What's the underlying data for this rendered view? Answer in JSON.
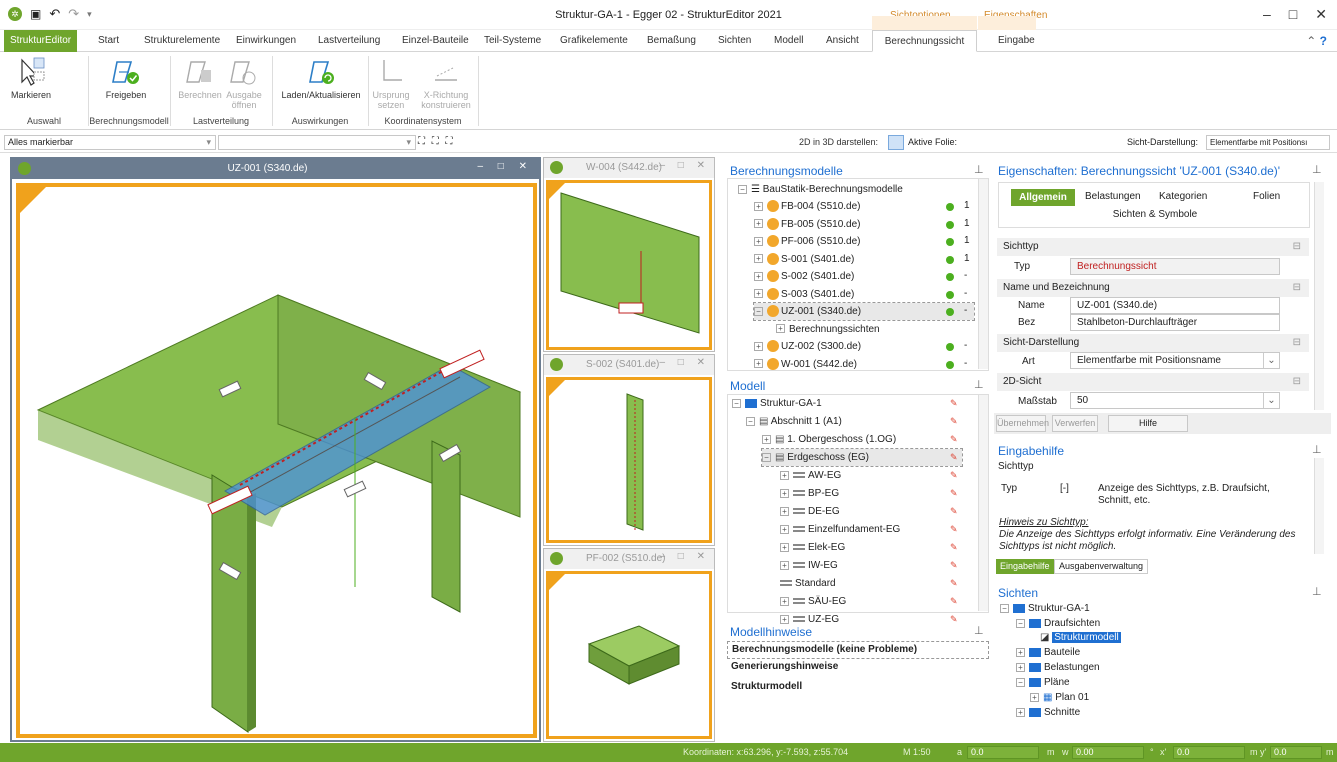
{
  "app": {
    "title": "Struktur-GA-1 - Egger 02 - StrukturEditor 2021",
    "context_tab1": "Sichtoptionen",
    "context_tab2": "Eigenschaften",
    "minimize": "–",
    "maximize": "□",
    "close": "✕"
  },
  "tabs": [
    "StrukturEditor",
    "Start",
    "Strukturelemente",
    "Einwirkungen",
    "Lastverteilung",
    "Einzel-Bauteile",
    "Teil-Systeme",
    "Grafikelemente",
    "Bemaßung",
    "Sichten",
    "Modell",
    "Ansicht",
    "Berechnungssicht",
    "Eingabe"
  ],
  "ribbon": {
    "markieren": "Markieren",
    "freigeben": "Freigeben",
    "berechnen": "Berechnen",
    "ausgabe": "Ausgabe\nöffnen",
    "laden": "Laden/Aktualisieren",
    "ursprung": "Ursprung\nsetzen",
    "xrichtung": "X-Richtung\nkonstruieren",
    "groups": [
      "Auswahl",
      "Berechnungsmodell",
      "Lastverteilung",
      "Auswirkungen",
      "Koordinatensystem"
    ]
  },
  "toolbar": {
    "selection": "Alles markierbar",
    "view2d": "2D in 3D darstellen:",
    "active_layer": "Aktive Folie:",
    "sicht_label": "Sicht-Darstellung:",
    "sicht_value": "Elementfarbe mit Positionsı"
  },
  "views": {
    "main": "UZ-001 (S340.de)",
    "w004": "W-004 (S442.de)",
    "s002": "S-002 (S401.de)",
    "pf002": "PF-002 (S510.de)"
  },
  "berechnungsmodelle": {
    "title": "Berechnungsmodelle",
    "root": "BauStatik-Berechnungsmodelle",
    "items": [
      {
        "label": "FB-004 (S510.de)",
        "col": "1"
      },
      {
        "label": "FB-005 (S510.de)",
        "col": "1"
      },
      {
        "label": "PF-006 (S510.de)",
        "col": "1"
      },
      {
        "label": "S-001 (S401.de)",
        "col": "1"
      },
      {
        "label": "S-002 (S401.de)",
        "col": "-"
      },
      {
        "label": "S-003 (S401.de)",
        "col": "-"
      },
      {
        "label": "UZ-001 (S340.de)",
        "col": "-"
      },
      {
        "label": "Berechnungssichten",
        "col": ""
      },
      {
        "label": "UZ-002 (S300.de)",
        "col": "-"
      },
      {
        "label": "W-001 (S442.de)",
        "col": "-"
      }
    ]
  },
  "modell": {
    "title": "Modell",
    "items": [
      "Struktur-GA-1",
      "Abschnitt 1 (A1)",
      "1. Obergeschoss (1.OG)",
      "Erdgeschoss (EG)",
      "AW-EG",
      "BP-EG",
      "DE-EG",
      "Einzelfundament-EG",
      "Elek-EG",
      "IW-EG",
      "Standard",
      "SÄU-EG",
      "UZ-EG"
    ]
  },
  "hinweise": {
    "title": "Modellhinweise",
    "items": [
      "Berechnungsmodelle (keine Probleme)",
      "Generierungshinweise",
      "Strukturmodell"
    ]
  },
  "eigenschaften": {
    "title": "Eigenschaften: Berechnungssicht 'UZ-001 (S340.de)'",
    "tabs": [
      "Allgemein",
      "Belastungen",
      "Kategorien",
      "Folien",
      "Sichten & Symbole"
    ],
    "sichttyp": "Sichttyp",
    "typ_label": "Typ",
    "typ_value": "Berechnungssicht",
    "name_section": "Name und Bezeichnung",
    "name_label": "Name",
    "name_value": "UZ-001 (S340.de)",
    "bez_label": "Bez",
    "bez_value": "Stahlbeton-Durchlaufträger",
    "sicht_section": "Sicht-Darstellung",
    "art_label": "Art",
    "art_value": "Elementfarbe mit Positionsname",
    "sicht2d": "2D-Sicht",
    "massstab_label": "Maßstab",
    "massstab_value": "50",
    "btn_uebernehmen": "Übernehmen",
    "btn_verwerfen": "Verwerfen",
    "btn_hilfe": "Hilfe"
  },
  "eingabehilfe": {
    "title": "Eingabehilfe",
    "subtitle": "Sichttyp",
    "typ": "Typ",
    "unit": "[-]",
    "desc": "Anzeige des Sichttyps, z.B. Draufsicht, Schnitt, etc.",
    "hinweis_title": "Hinweis zu Sichttyp:",
    "hinweis_text": "Die Anzeige des Sichttyps erfolgt informativ. Eine Veränderung des Sichttyps ist nicht möglich.",
    "tab1": "Eingabehilfe",
    "tab2": "Ausgabenverwaltung"
  },
  "sichten": {
    "title": "Sichten",
    "items": [
      "Struktur-GA-1",
      "Draufsichten",
      "Strukturmodell",
      "Bauteile",
      "Belastungen",
      "Pläne",
      "Plan 01",
      "Schnitte"
    ]
  },
  "status": {
    "coords": "Koordinaten: x:63.296, y:-7.593, z:55.704",
    "scale": "M 1:50",
    "a_label": "a",
    "a_val": "0.0",
    "m1": "m",
    "w_label": "w",
    "w_val": "0.00",
    "deg": "°",
    "x_label": "x'",
    "x_val": "0.0",
    "m2": "m",
    "y_label": "y'",
    "y_val": "0.0",
    "m3": "m"
  }
}
